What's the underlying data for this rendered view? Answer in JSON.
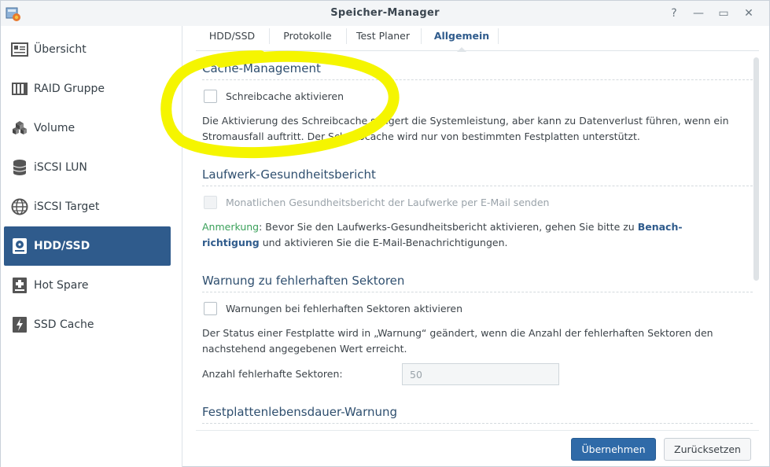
{
  "window": {
    "title": "Speicher-Manager"
  },
  "window_controls": {
    "help": "?",
    "minimize": "—",
    "maximize": "▭",
    "close": "✕"
  },
  "sidebar": {
    "items": [
      {
        "label": "Übersicht",
        "icon": "overview-icon"
      },
      {
        "label": "RAID Gruppe",
        "icon": "raid-icon"
      },
      {
        "label": "Volume",
        "icon": "volume-icon"
      },
      {
        "label": "iSCSI LUN",
        "icon": "database-icon"
      },
      {
        "label": "iSCSI Target",
        "icon": "globe-icon"
      },
      {
        "label": "HDD/SSD",
        "icon": "disk-icon",
        "active": true
      },
      {
        "label": "Hot Spare",
        "icon": "hot-spare-icon"
      },
      {
        "label": "SSD Cache",
        "icon": "ssd-cache-icon"
      }
    ]
  },
  "tabs": [
    {
      "label": "HDD/SSD"
    },
    {
      "label": "Protokolle"
    },
    {
      "label": "Test Planer"
    },
    {
      "label": "Allgemein",
      "active": true
    }
  ],
  "sections": {
    "cache": {
      "title": "Cache-Management",
      "checkbox_label": "Schreibcache aktivieren",
      "description": "Die Aktivierung des Schreibcache steigert die Systemleistung, aber kann zu Datenverlust führen, wenn ein Stromausfall auftritt. Der Schreibcache wird nur von bestimmten Festplatten unterstützt."
    },
    "health": {
      "title": "Laufwerk-Gesundheitsbericht",
      "checkbox_label": "Monatlichen Gesundheitsbericht der Laufwerke per E-Mail senden",
      "note_label": "Anmerkung",
      "note_text_before": ": Bevor Sie den Laufwerks-Gesundheitsbericht aktivieren, gehen Sie bitte zu ",
      "note_link": "Benach­richtigung",
      "note_link_line1": "Benach-",
      "note_link_line2": "richtigung",
      "note_text_after": " und aktivieren Sie die E-Mail-Benachrichtigungen."
    },
    "bad_sectors": {
      "title": "Warnung zu fehlerhaften Sektoren",
      "checkbox_label": "Warnungen bei fehlerhaften Sektoren aktivieren",
      "description": "Der Status einer Festplatte wird in „Warnung“ geändert, wenn die Anzahl der fehlerhaften Sektoren den nachstehend angegebenen Wert erreicht.",
      "field_label": "Anzahl fehlerhafte Sektoren:",
      "field_value": "50"
    },
    "lifespan": {
      "title": "Festplattenlebensdauer-Warnung"
    }
  },
  "footer": {
    "apply_label": "Übernehmen",
    "reset_label": "Zurücksetzen"
  },
  "colors": {
    "accent": "#2f5b8c",
    "highlight": "#f5f500",
    "note": "#3aa05a"
  }
}
